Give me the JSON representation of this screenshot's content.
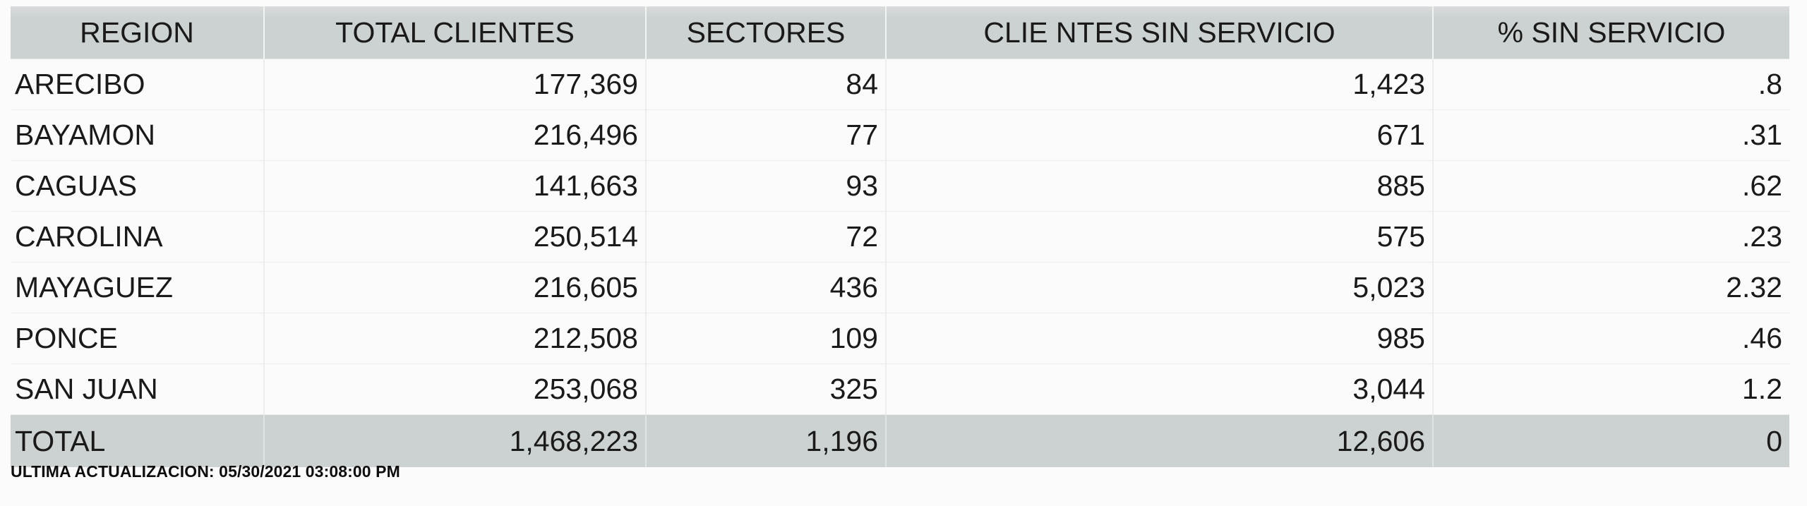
{
  "table": {
    "columns": [
      {
        "key": "region",
        "label": "REGION",
        "align": "left"
      },
      {
        "key": "clientes",
        "label": "TOTAL CLIENTES",
        "align": "right"
      },
      {
        "key": "sectores",
        "label": "SECTORES",
        "align": "right"
      },
      {
        "key": "sinserv",
        "label": "CLIE NTES SIN SERVICIO",
        "align": "right"
      },
      {
        "key": "pct",
        "label": "% SIN SERVICIO",
        "align": "right"
      }
    ],
    "rows": [
      {
        "region": "ARECIBO",
        "clientes": "177,369",
        "sectores": "84",
        "sinserv": "1,423",
        "pct": ".8"
      },
      {
        "region": "BAYAMON",
        "clientes": "216,496",
        "sectores": "77",
        "sinserv": "671",
        "pct": ".31"
      },
      {
        "region": "CAGUAS",
        "clientes": "141,663",
        "sectores": "93",
        "sinserv": "885",
        "pct": ".62"
      },
      {
        "region": "CAROLINA",
        "clientes": "250,514",
        "sectores": "72",
        "sinserv": "575",
        "pct": ".23"
      },
      {
        "region": "MAYAGUEZ",
        "clientes": "216,605",
        "sectores": "436",
        "sinserv": "5,023",
        "pct": "2.32"
      },
      {
        "region": "PONCE",
        "clientes": "212,508",
        "sectores": "109",
        "sinserv": "985",
        "pct": ".46"
      },
      {
        "region": "SAN JUAN",
        "clientes": "253,068",
        "sectores": "325",
        "sinserv": "3,044",
        "pct": "1.2"
      }
    ],
    "total_row": {
      "region": "TOTAL",
      "clientes": "1,468,223",
      "sectores": "1,196",
      "sinserv": "12,606",
      "pct": "0"
    }
  },
  "footer": {
    "last_update": "ULTIMA ACTUALIZACION: 05/30/2021 03:08:00 PM"
  },
  "colors": {
    "header_bg": "#ccd1d1",
    "total_bg": "#ccd1d1",
    "row_bg": "#fbfbfb",
    "text": "#1a1a1a",
    "grid_line": "#eaecec"
  },
  "chart_data": {
    "type": "table",
    "title": "",
    "columns": [
      "REGION",
      "TOTAL CLIENTES",
      "SECTORES",
      "CLIE NTES SIN SERVICIO",
      "% SIN SERVICIO"
    ],
    "categories": [
      "ARECIBO",
      "BAYAMON",
      "CAGUAS",
      "CAROLINA",
      "MAYAGUEZ",
      "PONCE",
      "SAN JUAN",
      "TOTAL"
    ],
    "series": [
      {
        "name": "TOTAL CLIENTES",
        "values": [
          177369,
          216496,
          141663,
          250514,
          216605,
          212508,
          253068,
          1468223
        ]
      },
      {
        "name": "SECTORES",
        "values": [
          84,
          77,
          93,
          72,
          436,
          109,
          325,
          1196
        ]
      },
      {
        "name": "CLIE NTES SIN SERVICIO",
        "values": [
          1423,
          671,
          885,
          575,
          5023,
          985,
          3044,
          12606
        ]
      },
      {
        "name": "% SIN SERVICIO",
        "values": [
          0.8,
          0.31,
          0.62,
          0.23,
          2.32,
          0.46,
          1.2,
          0
        ]
      }
    ]
  }
}
